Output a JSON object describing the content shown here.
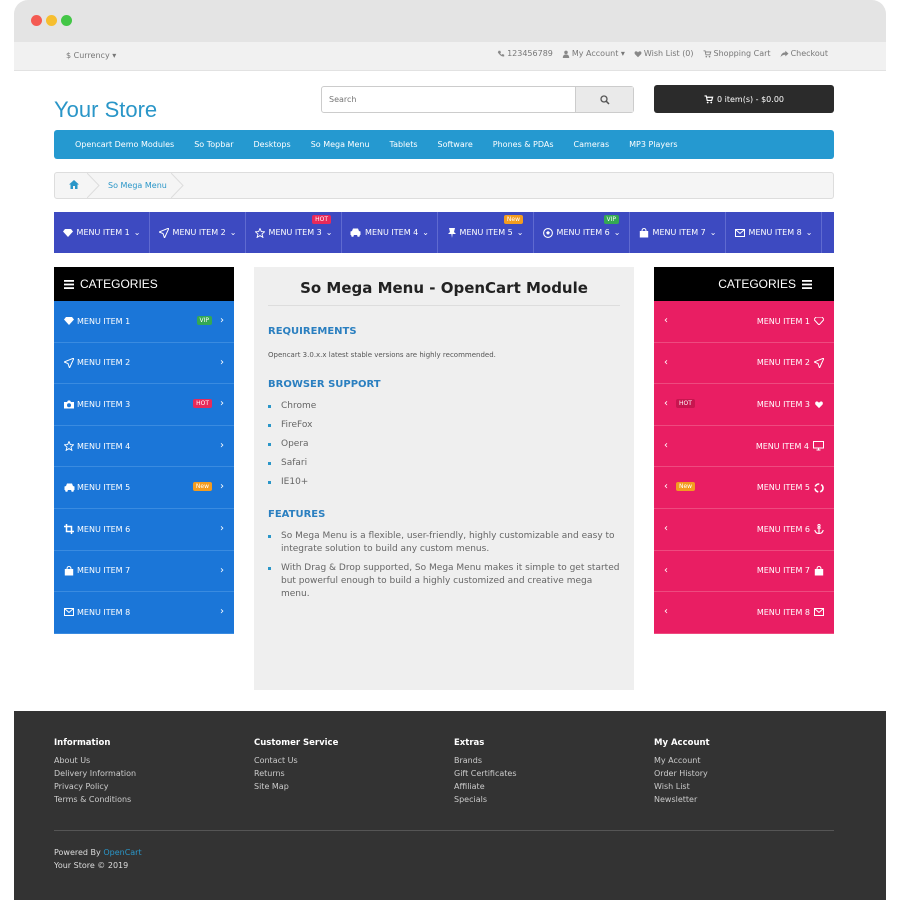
{
  "topbar": {
    "currency": "$ Currency ▾",
    "phone": "123456789",
    "my_account": "My Account ▾",
    "wish_list": "Wish List (0)",
    "shopping_cart": "Shopping Cart",
    "checkout": "Checkout"
  },
  "header": {
    "logo": "Your Store",
    "search_placeholder": "Search",
    "cart": "0 item(s) - $0.00"
  },
  "main_nav": [
    "Opencart Demo Modules",
    "So Topbar",
    "Desktops",
    "So Mega Menu",
    "Tablets",
    "Software",
    "Phones & PDAs",
    "Cameras",
    "MP3 Players"
  ],
  "breadcrumb": {
    "current": "So Mega Menu"
  },
  "mega_menu": [
    {
      "label": "MENU ITEM 1",
      "icon": "diamond-icon",
      "badge": ""
    },
    {
      "label": "MENU ITEM 2",
      "icon": "paper-plane-icon",
      "badge": ""
    },
    {
      "label": "MENU ITEM 3",
      "icon": "star-icon",
      "badge": "HOT"
    },
    {
      "label": "MENU ITEM 4",
      "icon": "car-icon",
      "badge": ""
    },
    {
      "label": "MENU ITEM 5",
      "icon": "pin-icon",
      "badge": "New"
    },
    {
      "label": "MENU ITEM 6",
      "icon": "soccer-ball-icon",
      "badge": "VIP"
    },
    {
      "label": "MENU ITEM 7",
      "icon": "shopping-bag-icon",
      "badge": ""
    },
    {
      "label": "MENU ITEM 8",
      "icon": "envelope-icon",
      "badge": ""
    }
  ],
  "left_categories": {
    "title": "CATEGORIES",
    "items": [
      {
        "label": "MENU ITEM 1",
        "icon": "diamond-icon",
        "badge": "VIP"
      },
      {
        "label": "MENU ITEM 2",
        "icon": "paper-plane-icon",
        "badge": ""
      },
      {
        "label": "MENU ITEM 3",
        "icon": "camera-icon",
        "badge": "HOT"
      },
      {
        "label": "MENU ITEM 4",
        "icon": "star-icon",
        "badge": ""
      },
      {
        "label": "MENU ITEM 5",
        "icon": "car-icon",
        "badge": "New"
      },
      {
        "label": "MENU ITEM 6",
        "icon": "crop-icon",
        "badge": ""
      },
      {
        "label": "MENU ITEM 7",
        "icon": "shopping-bag-icon",
        "badge": ""
      },
      {
        "label": "MENU ITEM 8",
        "icon": "envelope-icon",
        "badge": ""
      }
    ]
  },
  "right_categories": {
    "title": "CATEGORIES",
    "items": [
      {
        "label": "MENU ITEM 1",
        "icon": "diamond-icon",
        "badge": ""
      },
      {
        "label": "MENU ITEM 2",
        "icon": "paper-plane-icon",
        "badge": ""
      },
      {
        "label": "MENU ITEM 3",
        "icon": "heart-icon",
        "badge": "HOT"
      },
      {
        "label": "MENU ITEM 4",
        "icon": "desktop-icon",
        "badge": ""
      },
      {
        "label": "MENU ITEM 5",
        "icon": "recycle-icon",
        "badge": "New"
      },
      {
        "label": "MENU ITEM 6",
        "icon": "anchor-icon",
        "badge": ""
      },
      {
        "label": "MENU ITEM 7",
        "icon": "shopping-bag-icon",
        "badge": ""
      },
      {
        "label": "MENU ITEM 8",
        "icon": "envelope-icon",
        "badge": ""
      }
    ]
  },
  "content": {
    "title": "So Mega Menu - OpenCart Module",
    "requirements_heading": "REQUIREMENTS",
    "requirements_text": "Opencart 3.0.x.x latest stable versions are highly recommended.",
    "browser_heading": "BROWSER SUPPORT",
    "browsers": [
      "Chrome",
      "FireFox",
      "Opera",
      "Safari",
      "IE10+"
    ],
    "features_heading": "FEATURES",
    "features": [
      "So Mega Menu is a flexible, user-friendly, highly customizable and easy to integrate solution to build any custom menus.",
      "With Drag & Drop supported, So Mega Menu makes it simple to get started but powerful enough to build a highly customized and creative mega menu."
    ]
  },
  "footer": {
    "columns": [
      {
        "title": "Information",
        "links": [
          "About Us",
          "Delivery Information",
          "Privacy Policy",
          "Terms & Conditions"
        ]
      },
      {
        "title": "Customer Service",
        "links": [
          "Contact Us",
          "Returns",
          "Site Map"
        ]
      },
      {
        "title": "Extras",
        "links": [
          "Brands",
          "Gift Certificates",
          "Affiliate",
          "Specials"
        ]
      },
      {
        "title": "My Account",
        "links": [
          "My Account",
          "Order History",
          "Wish List",
          "Newsletter"
        ]
      }
    ],
    "powered_prefix": "Powered By ",
    "powered_link": "OpenCart",
    "copyright": "Your Store © 2019"
  },
  "colors": {
    "brand_blue": "#2599d0",
    "mega_menu_bg": "#3d4ac1",
    "left_sidebar_bg": "#1b76d8",
    "right_sidebar_bg": "#e91e63",
    "hot_badge": "#e82a5a",
    "new_badge": "#f39c1f",
    "vip_badge": "#34a853"
  }
}
